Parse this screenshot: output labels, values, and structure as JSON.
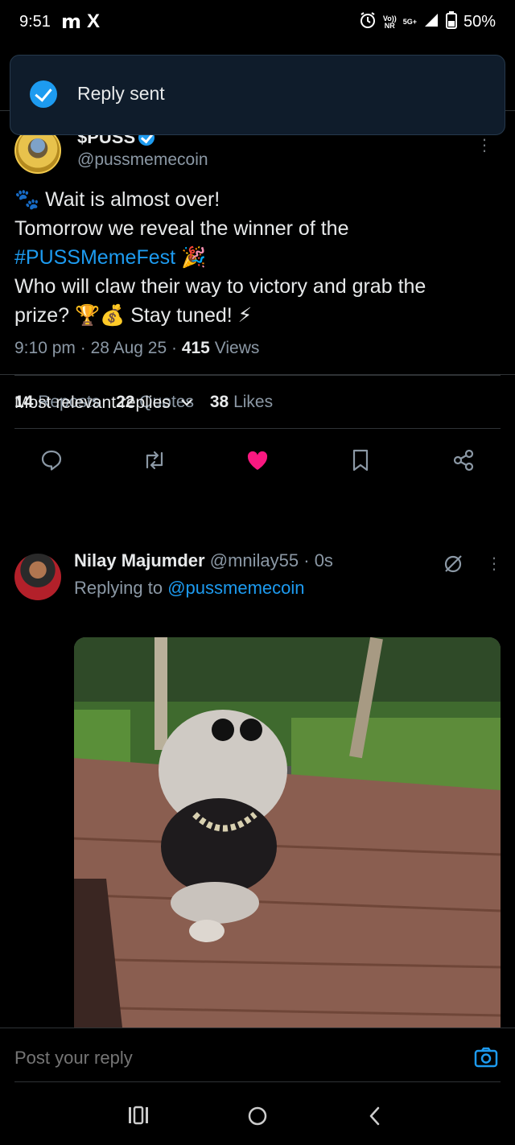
{
  "status_bar": {
    "time": "9:51",
    "app_icons": [
      "m",
      "X"
    ],
    "volte": "Vo))",
    "nr": "NR",
    "network": "5G+",
    "battery": "50%"
  },
  "toast": {
    "text": "Reply sent"
  },
  "tweet": {
    "author_name": "$PUSS",
    "author_handle": "@pussmemecoin",
    "lines": {
      "l1": "🐾 Wait is almost over!",
      "l2": "Tomorrow we reveal the winner of the",
      "hashtag": "#PUSSMemeFest",
      "l3_emoji": "🎉",
      "l4": "Who will claw their way to victory and grab the",
      "l5": "prize? 🏆💰 Stay tuned! ⚡"
    },
    "time": "9:10 pm",
    "date": "28 Aug 25",
    "views_count": "415",
    "views_label": "Views",
    "stats": {
      "reposts_count": "14",
      "reposts_label": "Reposts",
      "quotes_count": "22",
      "quotes_label": "Quotes",
      "likes_count": "38",
      "likes_label": "Likes"
    },
    "liked_color": "#f91880"
  },
  "replies_header": {
    "label": "Most relevant replies"
  },
  "reply": {
    "author_name": "Nilay Majumder",
    "author_handle": "@mnilay55",
    "time": "0s",
    "replying_prefix": "Replying to",
    "replying_to": "@pussmemecoin"
  },
  "composer": {
    "placeholder": "Post your reply"
  },
  "colors": {
    "accent": "#1d9bf0",
    "background": "#000000"
  }
}
